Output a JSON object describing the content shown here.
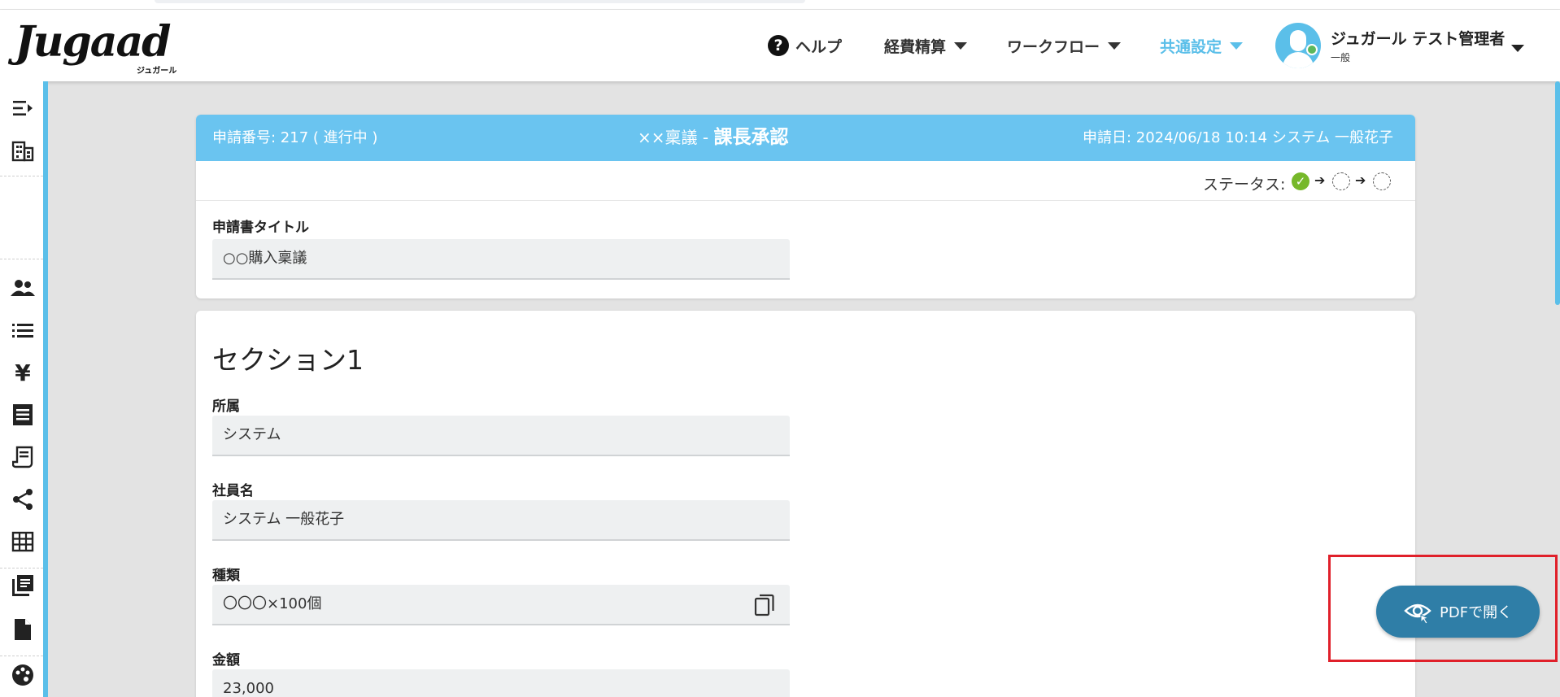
{
  "brand": {
    "logo_text": "Jugaad",
    "logo_sub": "ジュガール"
  },
  "nav": {
    "help": "ヘルプ",
    "keihi": "経費精算",
    "workflow": "ワークフロー",
    "settings": "共通設定"
  },
  "user": {
    "name": "ジュガール テスト管理者",
    "role": "一般"
  },
  "application": {
    "number": "申請番号: 217 ( 進行中 )",
    "title_prefix": "××稟議 - ",
    "title_step": "課長承認",
    "date_applicant": "申請日: 2024/06/18 10:14  システム 一般花子",
    "status_label": "ステータス:"
  },
  "form_title": {
    "label": "申請書タイトル",
    "value": "○○購入稟議"
  },
  "section": {
    "title": "セクション1",
    "fields": [
      {
        "label": "所属",
        "value": "システム"
      },
      {
        "label": "社員名",
        "value": "システム 一般花子"
      },
      {
        "label": "種類",
        "value": "〇〇〇×100個"
      },
      {
        "label": "金額",
        "value": "23,000"
      }
    ]
  },
  "pdf_button": {
    "label": "PDFで開く"
  },
  "colors": {
    "accent": "#5bbfe9",
    "header_bar": "#6ac4f0",
    "button": "#2f7ea7",
    "highlight": "#e0202a",
    "status_done": "#76b82a"
  },
  "icons": {
    "sidebar": [
      "collapse-menu-icon",
      "building-icon",
      "users-icon",
      "list-icon",
      "yen-icon",
      "receipt-icon",
      "receipt-long-icon",
      "share-icon",
      "table-icon",
      "library-icon",
      "document-icon",
      "palette-icon"
    ]
  }
}
